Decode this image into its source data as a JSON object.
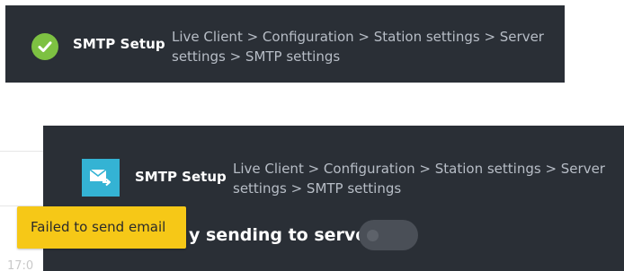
{
  "top_toast": {
    "title": "SMTP Setup",
    "breadcrumb": "Live Client > Configuration > Station settings > Server settings > SMTP settings",
    "icon": "check-circle-icon",
    "icon_color": "#7dc142",
    "background": "#2a2f36"
  },
  "panel": {
    "title": "SMTP Setup",
    "breadcrumb": "Live Client > Configuration > Station settings > Server settings > SMTP settings",
    "icon": "mail-send-icon",
    "icon_color": "#34b3d4",
    "setting_label": "y sending to server",
    "toggle_state": "off"
  },
  "error_tooltip": {
    "text": "Failed to send email",
    "color": "#f6c817"
  },
  "background_page": {
    "time_fragment": "17:0"
  }
}
